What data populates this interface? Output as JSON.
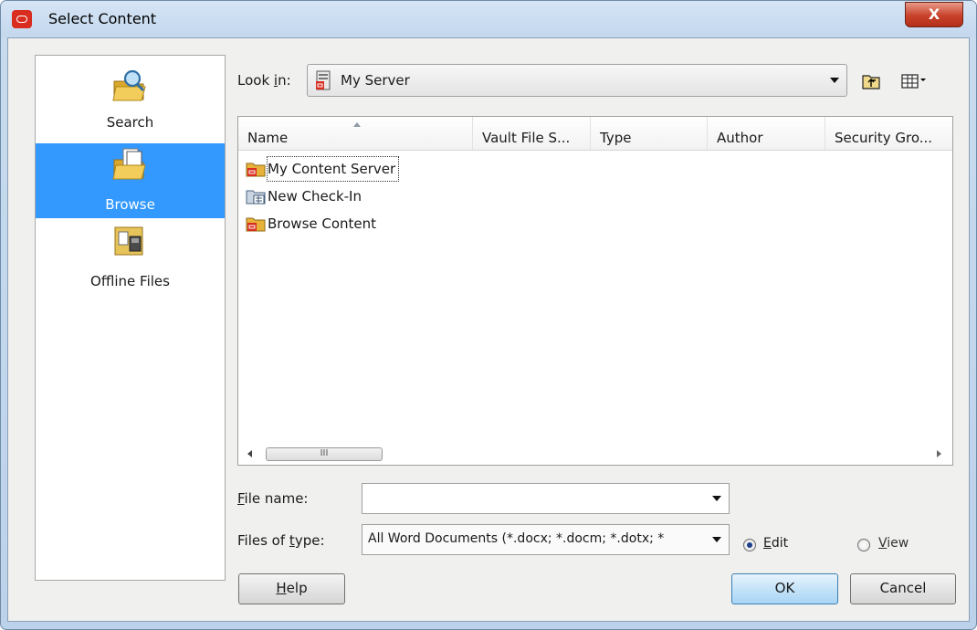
{
  "window": {
    "title": "Select Content",
    "close_label": "X"
  },
  "places": [
    {
      "label": "Search",
      "icon": "search-folder-icon",
      "selected": false
    },
    {
      "label": "Browse",
      "icon": "browse-folder-icon",
      "selected": true
    },
    {
      "label": "Offline Files",
      "icon": "offline-files-icon",
      "selected": false
    }
  ],
  "look_in": {
    "label_pre": "Look ",
    "label_mnemonic": "i",
    "label_post": "n:",
    "value": "My Server"
  },
  "columns": [
    "Name",
    "Vault File S...",
    "Type",
    "Author",
    "Security Gro..."
  ],
  "files": [
    {
      "name": "My Content Server",
      "icon": "content-server-folder-icon"
    },
    {
      "name": "New Check-In",
      "icon": "check-in-folder-icon"
    },
    {
      "name": "Browse Content",
      "icon": "browse-content-folder-icon"
    }
  ],
  "scrollbar_grip": "III",
  "file_name": {
    "label_mnemonic": "F",
    "label_post": "ile name:",
    "value": ""
  },
  "files_of_type": {
    "label_pre": "Files of ",
    "label_mnemonic": "t",
    "label_post": "ype:",
    "value": "All Word Documents (*.docx; *.docm; *.dotx; *"
  },
  "mode": {
    "edit_mnemonic": "E",
    "edit_post": "dit",
    "view_mnemonic": "V",
    "view_post": "iew",
    "selected": "Edit"
  },
  "buttons": {
    "help_mnemonic": "H",
    "help_post": "elp",
    "ok": "OK",
    "cancel": "Cancel"
  },
  "colors": {
    "selection": "#3399ff",
    "close_button": "#c9412a",
    "folder": "#e8b23a"
  }
}
